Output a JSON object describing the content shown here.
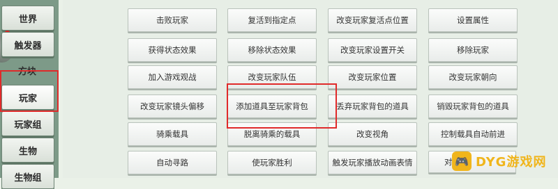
{
  "sidebar": {
    "items": [
      {
        "label": "世界"
      },
      {
        "label": "触发器"
      },
      {
        "label": "方块"
      },
      {
        "label": "玩家"
      },
      {
        "label": "玩家组"
      },
      {
        "label": "生物"
      },
      {
        "label": "生物组"
      }
    ]
  },
  "actions": [
    "击败玩家",
    "复活到指定点",
    "改变玩家复活点位置",
    "设置属性",
    "获得状态效果",
    "移除状态效果",
    "改变玩家设置开关",
    "移除玩家",
    "加入游戏观战",
    "改变玩家队伍",
    "改变玩家位置",
    "改变玩家朝向",
    "改变玩家镜头偏移",
    "添加道具至玩家背包",
    "丢弃玩家背包的道具",
    "销毁玩家背包的道具",
    "骑乘载具",
    "脱离骑乘的载具",
    "改变视角",
    "控制载具自动前进",
    "自动寻路",
    "使玩家胜利",
    "触发玩家播放动画表情",
    "对"
  ],
  "watermark": {
    "text": "DYG游戏网"
  },
  "colors": {
    "highlight": "#e02a2a",
    "watermark": "#f0b51c"
  }
}
